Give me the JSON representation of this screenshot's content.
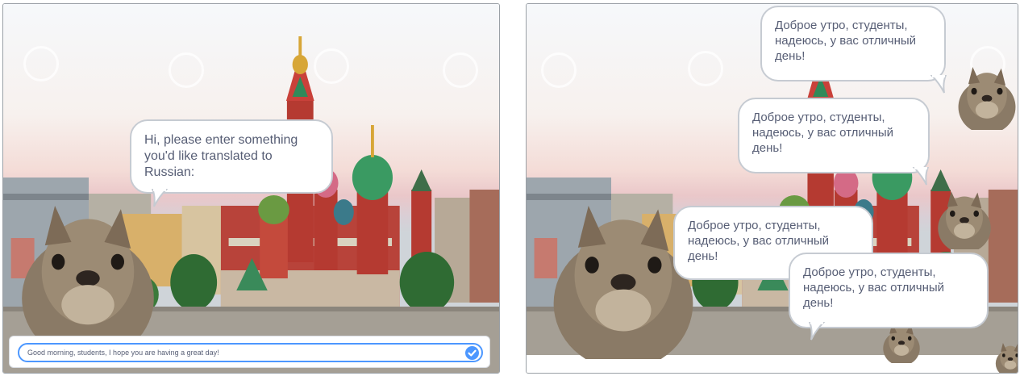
{
  "left_stage": {
    "bubble_text": "Hi, please enter something you'd like translated to Russian:",
    "ask_input_value": "Good morning, students, I hope you are having a great day!",
    "submit_icon": "check-icon"
  },
  "right_stage": {
    "bubbles": [
      "Доброе утро, студенты, надеюсь, у вас отличный день!",
      "Доброе утро, студенты, надеюсь, у вас отличный день!",
      "Доброе утро, студенты, надеюсь, у вас отличный день!",
      "Доброе утро, студенты, надеюсь, у вас отличный день!"
    ]
  },
  "colors": {
    "bubble_text": "#575e75",
    "bubble_border": "#c6cbd2",
    "accent": "#4c97ff"
  }
}
